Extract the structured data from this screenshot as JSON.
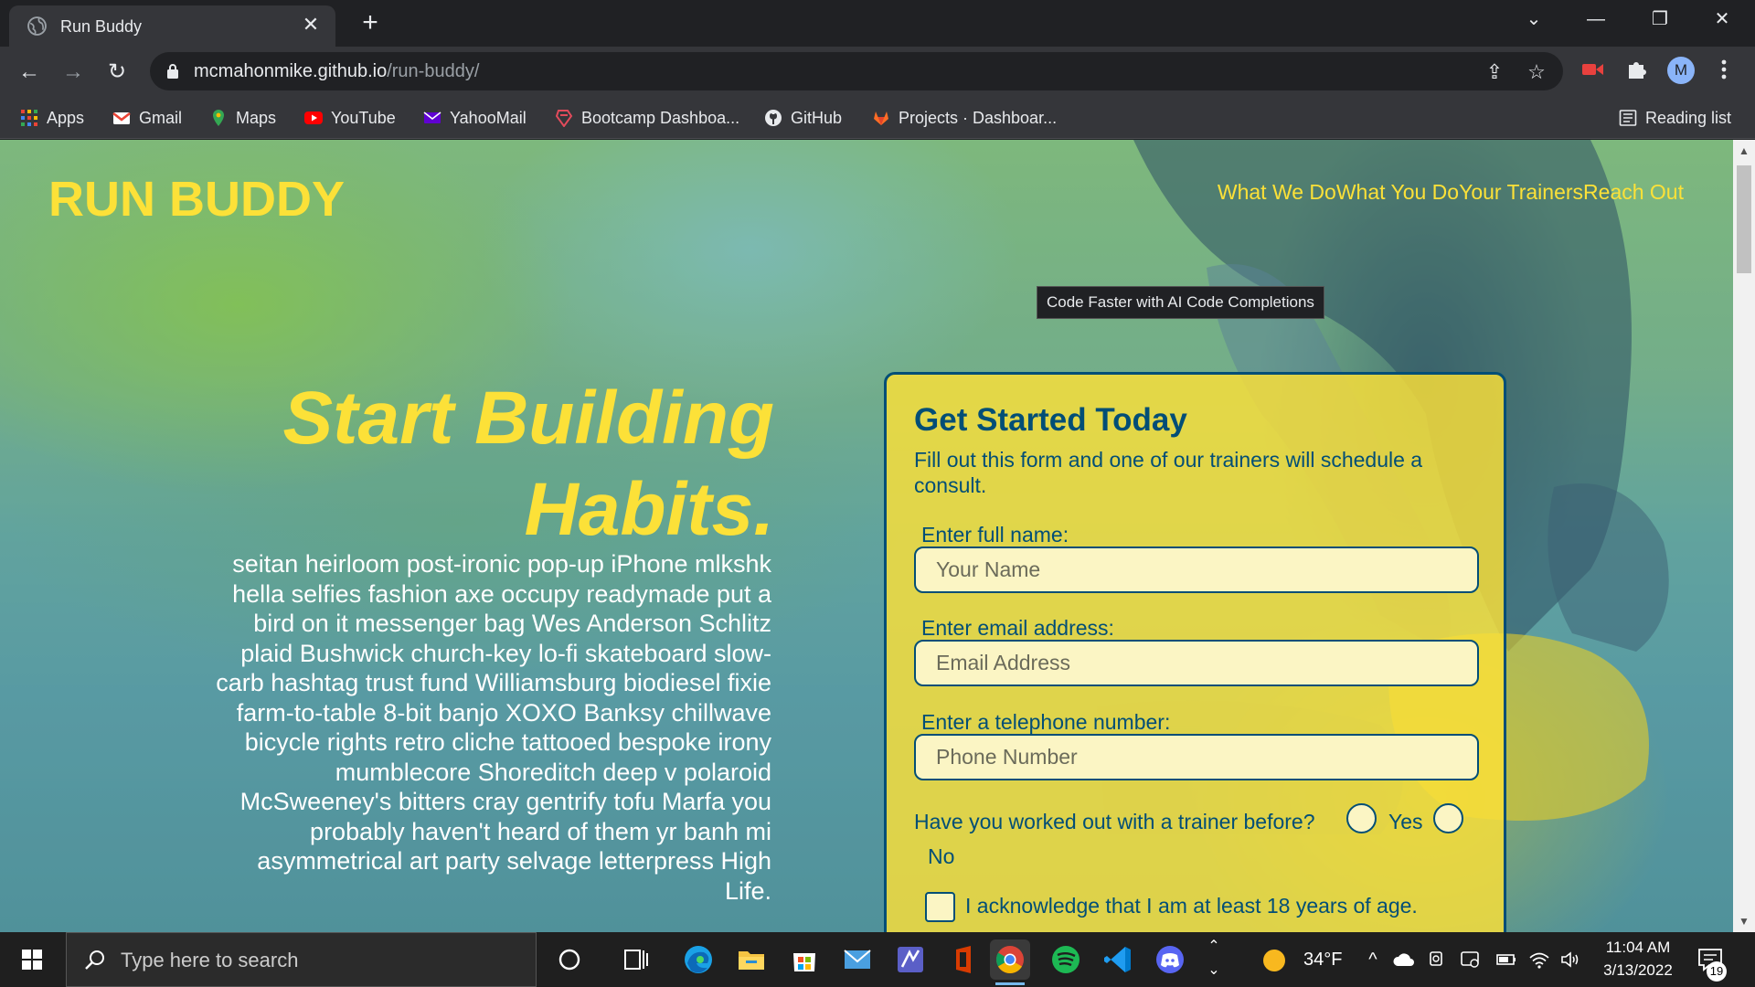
{
  "browser": {
    "tab_title": "Run Buddy",
    "close_glyph": "✕",
    "newtab_glyph": "+",
    "url_domain": "mcmahonmike.github.io",
    "url_path": "/run-buddy/",
    "tooltip": "Code Faster with AI Code Completions",
    "avatar_letter": "M",
    "window_controls": {
      "chevron": "⌄",
      "minimize": "—",
      "restore": "❐",
      "close": "✕"
    },
    "nav": {
      "back": "←",
      "forward": "→",
      "reload": "↻"
    },
    "omni_icons": {
      "share": "⇪",
      "star": "☆"
    },
    "bookmarks": [
      {
        "label": "Apps",
        "icon": "apps-grid-icon",
        "color": "#ea4335"
      },
      {
        "label": "Gmail",
        "icon": "gmail-icon",
        "color": "#ea4335"
      },
      {
        "label": "Maps",
        "icon": "maps-pin-icon",
        "color": "#34a853"
      },
      {
        "label": "YouTube",
        "icon": "youtube-icon",
        "color": "#ff0000"
      },
      {
        "label": "YahooMail",
        "icon": "yahoo-mail-icon",
        "color": "#6001d2"
      },
      {
        "label": "Bootcamp Dashboa...",
        "icon": "bootcamp-icon",
        "color": "#e24b5b"
      },
      {
        "label": "GitHub",
        "icon": "github-icon",
        "color": "#e8eaed"
      },
      {
        "label": "Projects · Dashboar...",
        "icon": "gitlab-icon",
        "color": "#fc6d26"
      }
    ],
    "reading_list": "Reading list"
  },
  "page": {
    "brand": "RUN BUDDY",
    "nav_links": [
      "What We Do",
      "What You Do",
      "Your Trainers",
      "Reach Out"
    ],
    "hero_title": "Start Building Habits.",
    "hero_text": "seitan heirloom post-ironic pop-up iPhone mlkshk hella selfies fashion axe occupy readymade put a bird on it messenger bag Wes Anderson Schlitz plaid Bushwick church-key lo-fi skateboard slow-carb hashtag trust fund Williamsburg biodiesel fixie farm-to-table 8-bit banjo XOXO Banksy chillwave bicycle rights retro cliche tattooed bespoke irony mumblecore Shoreditch deep v polaroid McSweeney's bitters cray gentrify tofu Marfa you probably haven't heard of them yr banh mi asymmetrical art party selvage letterpress High Life.",
    "form": {
      "title": "Get Started Today",
      "subtitle": "Fill out this form and one of our trainers will schedule a consult.",
      "name_label": "Enter full name:",
      "name_placeholder": "Your Name",
      "email_label": "Enter email address:",
      "email_placeholder": "Email Address",
      "phone_label": "Enter a telephone number:",
      "phone_placeholder": "Phone Number",
      "trainer_question": "Have you worked out with a trainer before?",
      "yes_label": "Yes",
      "no_label": "No",
      "ack_label": "I acknowledge that I am at least 18 years of age."
    }
  },
  "taskbar": {
    "search_placeholder": "Type here to search",
    "weather": "34°F",
    "time": "11:04 AM",
    "date": "3/13/2022",
    "notification_count": "19",
    "up_glyph": "⌃",
    "down_glyph": "⌄",
    "tray_up": "^",
    "apps": [
      {
        "name": "cortana",
        "color": "#1f1f1f"
      },
      {
        "name": "task-view",
        "color": "#1f1f1f"
      },
      {
        "name": "edge",
        "color": "#1aa1e6"
      },
      {
        "name": "file-explorer",
        "color": "#f5c443"
      },
      {
        "name": "microsoft-store",
        "color": "#0078d4"
      },
      {
        "name": "mail",
        "color": "#0a64c2"
      },
      {
        "name": "visual-studio",
        "color": "#5b5fc7"
      },
      {
        "name": "office",
        "color": "#d83b01"
      },
      {
        "name": "chrome",
        "color": "#34a853"
      },
      {
        "name": "spotify",
        "color": "#1db954"
      },
      {
        "name": "vscode",
        "color": "#007acc"
      },
      {
        "name": "discord",
        "color": "#5865f2"
      }
    ]
  },
  "colors": {
    "accent": "#fce138",
    "navy": "#024e76"
  }
}
